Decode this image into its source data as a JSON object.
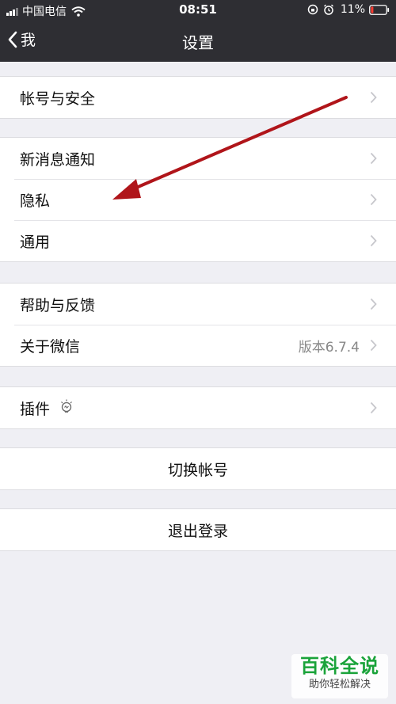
{
  "status_bar": {
    "carrier": "中国电信",
    "time": "08:51",
    "battery": "11%"
  },
  "nav": {
    "back_label": "我",
    "title": "设置"
  },
  "groups": [
    {
      "rows": [
        {
          "label": "帐号与安全"
        }
      ]
    },
    {
      "rows": [
        {
          "label": "新消息通知"
        },
        {
          "label": "隐私"
        },
        {
          "label": "通用"
        }
      ]
    },
    {
      "rows": [
        {
          "label": "帮助与反馈"
        },
        {
          "label": "关于微信",
          "value": "版本6.7.4"
        }
      ]
    },
    {
      "rows": [
        {
          "label": "插件"
        }
      ]
    }
  ],
  "actions": {
    "switch_account": "切换帐号",
    "logout": "退出登录"
  },
  "annotation": {
    "arrow_color": "#b0151a"
  },
  "watermark": {
    "title": "百科全说",
    "subtitle": "助你轻松解决"
  },
  "colors": {
    "nav_background": "#2e2e33",
    "page_background": "#efeff4",
    "cell_background": "#ffffff"
  }
}
